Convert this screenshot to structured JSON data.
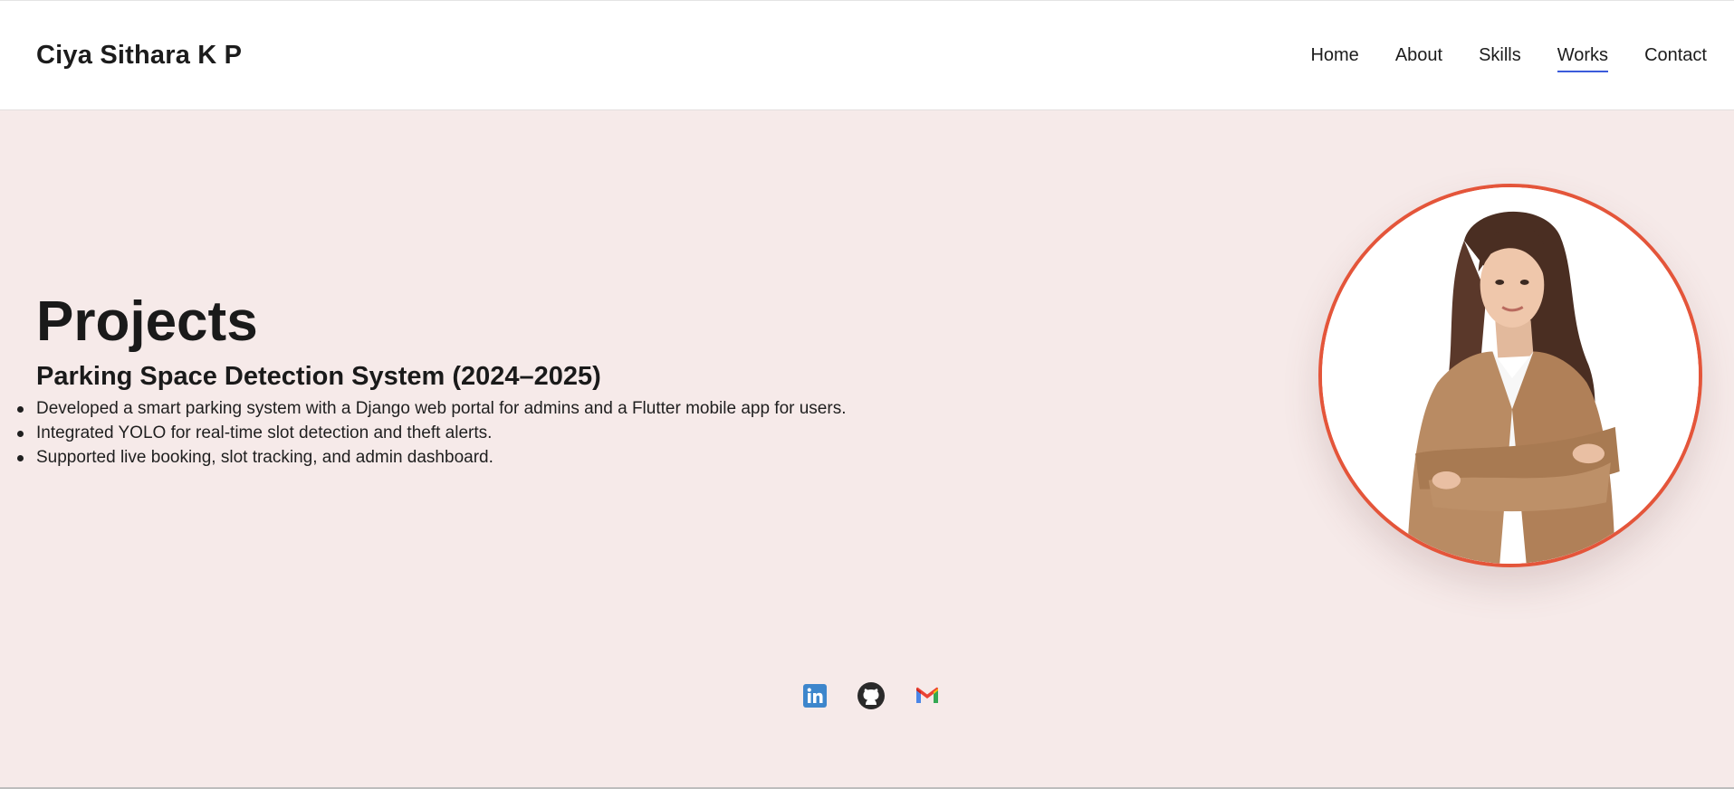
{
  "header": {
    "brand": "Ciya Sithara K P",
    "nav": [
      {
        "label": "Home"
      },
      {
        "label": "About"
      },
      {
        "label": "Skills"
      },
      {
        "label": "Works",
        "active": true
      },
      {
        "label": "Contact"
      }
    ]
  },
  "main": {
    "section_title": "Projects",
    "project": {
      "title": "Parking Space Detection System (2024–2025)",
      "bullets": [
        "Developed a smart parking system with a Django web portal for admins and a Flutter mobile app for users.",
        "Integrated YOLO for real-time slot detection and theft alerts.",
        "Supported live booking, slot tracking, and admin dashboard."
      ]
    },
    "profile_photo": {
      "icon": "portrait-photo",
      "border_color": "#e4553a"
    }
  },
  "socials": [
    {
      "icon": "linkedin-icon"
    },
    {
      "icon": "github-icon"
    },
    {
      "icon": "gmail-icon"
    }
  ],
  "colors": {
    "hero_background": "#f6eae9",
    "accent_underline": "#3b5bdb",
    "photo_ring": "#e4553a"
  }
}
